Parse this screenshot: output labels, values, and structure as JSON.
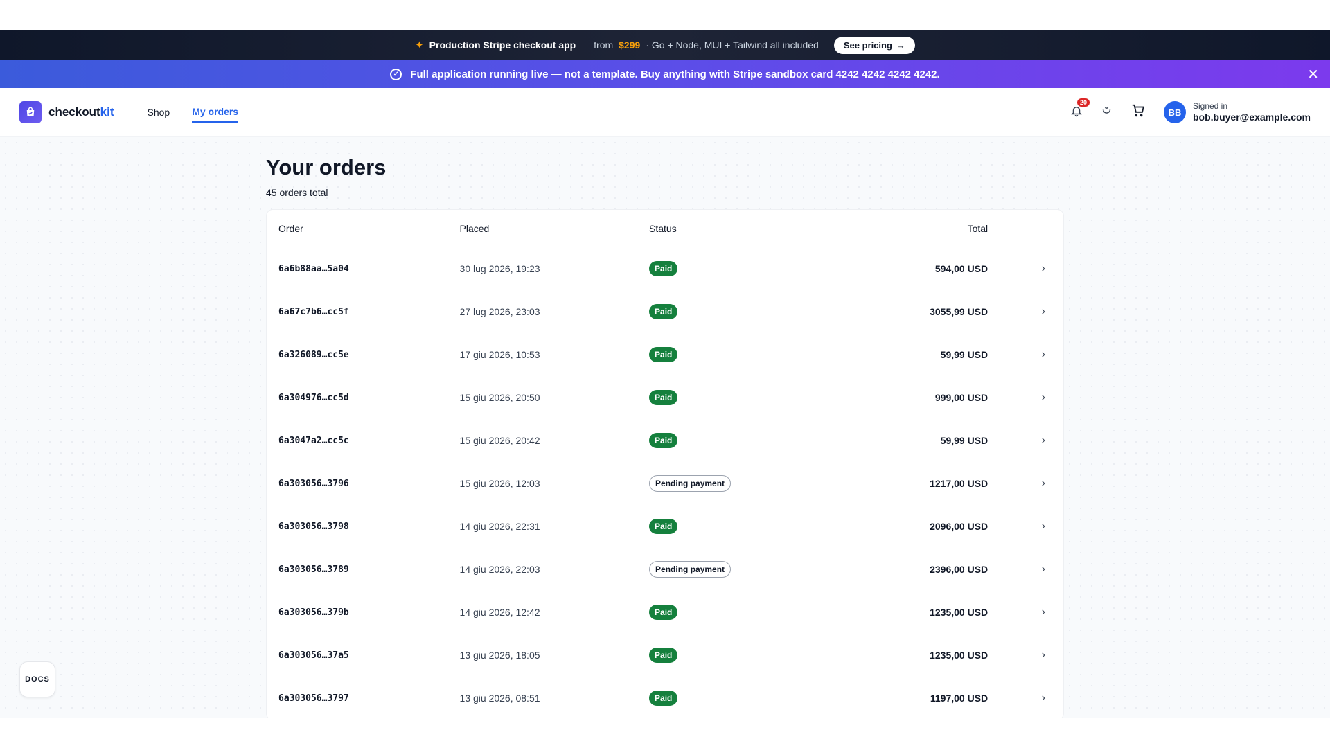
{
  "promo": {
    "icon": "sparkles-icon",
    "title": "Production Stripe checkout app",
    "dash": "— from",
    "price": "$299",
    "rest": "· Go + Node, MUI + Tailwind all included",
    "button_label": "See pricing",
    "accent_color": "#f59e0b"
  },
  "live_banner": {
    "text": "Full application running live — not a template. Buy anything with Stripe sandbox card 4242  4242  4242  4242."
  },
  "nav": {
    "logo_main": "checkout",
    "logo_accent": "kit",
    "links": [
      {
        "label": "Shop",
        "active": false
      },
      {
        "label": "My orders",
        "active": true
      }
    ],
    "notifications_count": "20",
    "avatar_initials": "BB",
    "signed_label": "Signed in",
    "email": "bob.buyer@example.com",
    "brand_color": "#2563eb"
  },
  "page": {
    "title": "Your orders",
    "subtitle": "45 orders total"
  },
  "table": {
    "columns": [
      "Order",
      "Placed",
      "Status",
      "Total"
    ],
    "rows": [
      {
        "id": "6a6b88aa…5a04",
        "placed": "30 lug 2026, 19:23",
        "status": "Paid",
        "total": "594,00 USD"
      },
      {
        "id": "6a67c7b6…cc5f",
        "placed": "27 lug 2026, 23:03",
        "status": "Paid",
        "total": "3055,99 USD"
      },
      {
        "id": "6a326089…cc5e",
        "placed": "17 giu 2026, 10:53",
        "status": "Paid",
        "total": "59,99 USD"
      },
      {
        "id": "6a304976…cc5d",
        "placed": "15 giu 2026, 20:50",
        "status": "Paid",
        "total": "999,00 USD"
      },
      {
        "id": "6a3047a2…cc5c",
        "placed": "15 giu 2026, 20:42",
        "status": "Paid",
        "total": "59,99 USD"
      },
      {
        "id": "6a303056…3796",
        "placed": "15 giu 2026, 12:03",
        "status": "Pending payment",
        "total": "1217,00 USD"
      },
      {
        "id": "6a303056…3798",
        "placed": "14 giu 2026, 22:31",
        "status": "Paid",
        "total": "2096,00 USD"
      },
      {
        "id": "6a303056…3789",
        "placed": "14 giu 2026, 22:03",
        "status": "Pending payment",
        "total": "2396,00 USD"
      },
      {
        "id": "6a303056…379b",
        "placed": "14 giu 2026, 12:42",
        "status": "Paid",
        "total": "1235,00 USD"
      },
      {
        "id": "6a303056…37a5",
        "placed": "13 giu 2026, 18:05",
        "status": "Paid",
        "total": "1235,00 USD"
      },
      {
        "id": "6a303056…3797",
        "placed": "13 giu 2026, 08:51",
        "status": "Paid",
        "total": "1197,00 USD"
      }
    ],
    "paid_color": "#15803d"
  },
  "docs": {
    "label": "DOCS"
  }
}
